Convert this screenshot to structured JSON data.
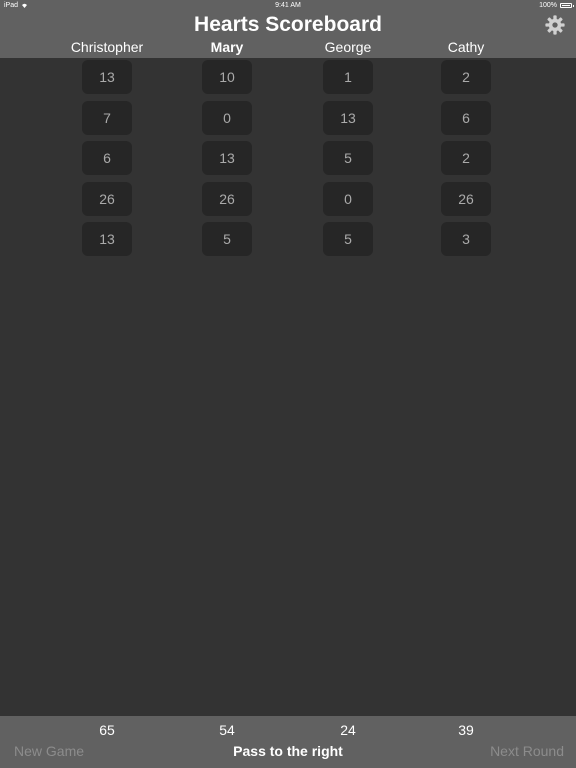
{
  "status_bar": {
    "carrier": "iPad",
    "time": "9:41 AM",
    "battery": "100%"
  },
  "header": {
    "title": "Hearts Scoreboard",
    "settings_icon": "gear-icon"
  },
  "players": [
    {
      "name": "Christopher",
      "current": false,
      "scores": [
        "13",
        "7",
        "6",
        "26",
        "13"
      ],
      "total": "65"
    },
    {
      "name": "Mary",
      "current": true,
      "scores": [
        "10",
        "0",
        "13",
        "26",
        "5"
      ],
      "total": "54"
    },
    {
      "name": "George",
      "current": false,
      "scores": [
        "1",
        "13",
        "5",
        "0",
        "5"
      ],
      "total": "24"
    },
    {
      "name": "Cathy",
      "current": false,
      "scores": [
        "2",
        "6",
        "2",
        "26",
        "3"
      ],
      "total": "39"
    }
  ],
  "footer": {
    "new_game": "New Game",
    "pass_direction": "Pass to the right",
    "next_round": "Next Round"
  },
  "colors": {
    "background": "#333333",
    "bar": "#616161",
    "cell": "#262626",
    "cell_text": "#aaaaaa",
    "disabled_text": "#8c8c8c"
  }
}
